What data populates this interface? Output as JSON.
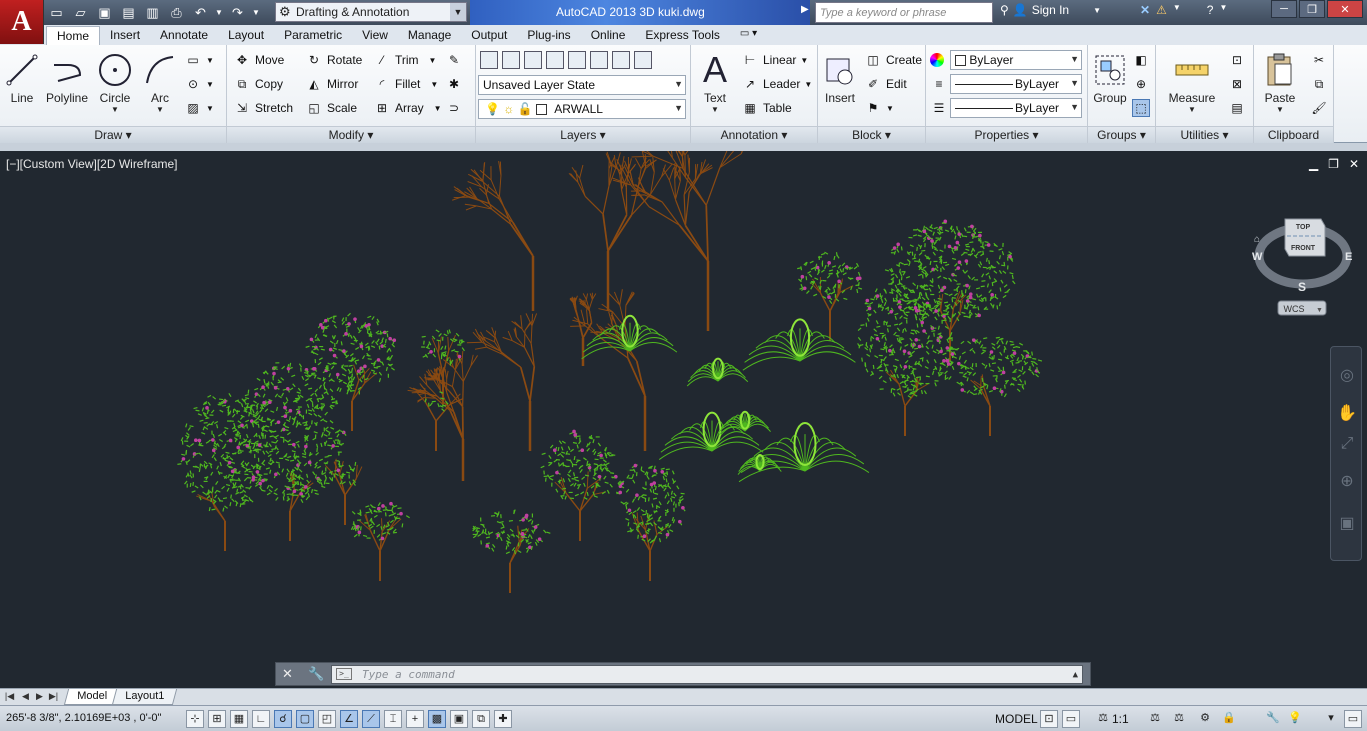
{
  "app": {
    "logo_letter": "A",
    "title": "AutoCAD 2013   3D kuki.dwg",
    "workspace": "Drafting & Annotation",
    "search_placeholder": "Type a keyword or phrase",
    "sign_in": "Sign In"
  },
  "ribbon_tabs": [
    "Home",
    "Insert",
    "Annotate",
    "Layout",
    "Parametric",
    "View",
    "Manage",
    "Output",
    "Plug-ins",
    "Online",
    "Express Tools"
  ],
  "panels": {
    "draw": {
      "title": "Draw",
      "line": "Line",
      "polyline": "Polyline",
      "circle": "Circle",
      "arc": "Arc"
    },
    "modify": {
      "title": "Modify",
      "move": "Move",
      "rotate": "Rotate",
      "trim": "Trim",
      "copy": "Copy",
      "mirror": "Mirror",
      "fillet": "Fillet",
      "stretch": "Stretch",
      "scale": "Scale",
      "array": "Array"
    },
    "layers": {
      "title": "Layers",
      "layer_state": "Unsaved Layer State",
      "current_layer": "ARWALL"
    },
    "annotation": {
      "title": "Annotation",
      "text": "Text",
      "linear": "Linear",
      "leader": "Leader",
      "table": "Table"
    },
    "block": {
      "title": "Block",
      "insert": "Insert",
      "create": "Create",
      "edit": "Edit"
    },
    "properties": {
      "title": "Properties",
      "color": "ByLayer",
      "linetype": "ByLayer",
      "lineweight": "ByLayer"
    },
    "groups": {
      "title": "Groups",
      "group": "Group"
    },
    "utilities": {
      "title": "Utilities",
      "measure": "Measure"
    },
    "clipboard": {
      "title": "Clipboard",
      "paste": "Paste"
    }
  },
  "viewport": {
    "label": "[−][Custom View][2D Wireframe]",
    "viewcube": {
      "top": "TOP",
      "front": "FRONT",
      "w": "W",
      "e": "E",
      "s": "S",
      "wcs": "WCS"
    }
  },
  "command": {
    "placeholder": "Type a command"
  },
  "layout_tabs": [
    "Model",
    "Layout1"
  ],
  "status": {
    "coords": "265'-8 3/8\",  2.10169E+03 , 0'-0\"",
    "model": "MODEL",
    "scale": "1:1"
  },
  "colors": {
    "viewport_bg": "#212830",
    "trunk": "#8a4a12",
    "foliage": "#4fb81f",
    "flower": "#c040a0",
    "fern": "#8ee53a"
  }
}
